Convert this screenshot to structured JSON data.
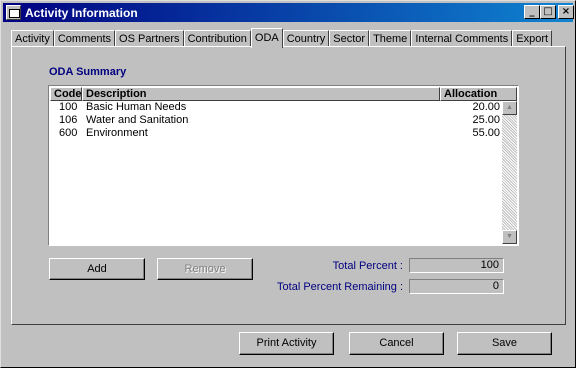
{
  "window": {
    "title": "Activity Information",
    "minimize_glyph": "_",
    "maximize_glyph": "□",
    "close_glyph": "×"
  },
  "tabs": [
    {
      "label": "Activity"
    },
    {
      "label": "Comments"
    },
    {
      "label": "OS Partners"
    },
    {
      "label": "Contribution"
    },
    {
      "label": "ODA",
      "active": true
    },
    {
      "label": "Country"
    },
    {
      "label": "Sector"
    },
    {
      "label": "Theme"
    },
    {
      "label": "Internal Comments"
    },
    {
      "label": "Export"
    }
  ],
  "oda": {
    "section_title": "ODA Summary",
    "columns": {
      "code": "Code",
      "description": "Description",
      "allocation": "Allocation"
    },
    "rows": [
      {
        "code": "100",
        "description": "Basic Human Needs",
        "allocation": "20.00"
      },
      {
        "code": "106",
        "description": "Water and Sanitation",
        "allocation": "25.00"
      },
      {
        "code": "600",
        "description": "Environment",
        "allocation": "55.00"
      }
    ],
    "add_label": "Add",
    "remove_label": "Remove",
    "total_percent_label": "Total Percent :",
    "total_percent_value": "100",
    "remaining_label": "Total Percent Remaining :",
    "remaining_value": "0"
  },
  "footer": {
    "print_label": "Print Activity",
    "cancel_label": "Cancel",
    "save_label": "Save"
  }
}
